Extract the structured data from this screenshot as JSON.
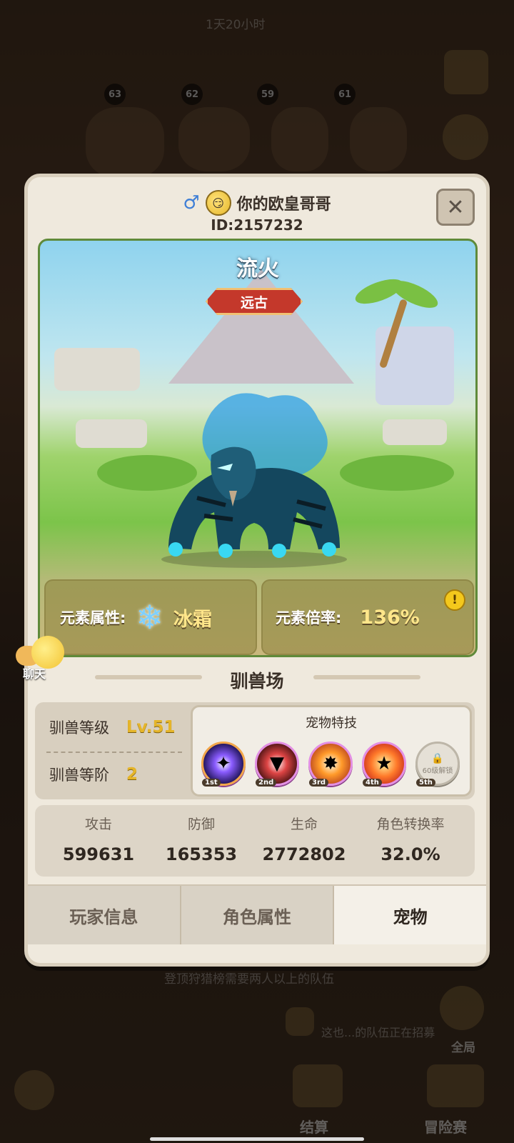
{
  "background": {
    "top_timer": "1天20小时",
    "player_levels": [
      "63",
      "62",
      "59",
      "61"
    ],
    "notice": "登顶狩猎榜需要两人以上的队伍",
    "team_notice": "这也...的队伍正在招募",
    "btn_global": "全局",
    "btn_settle": "结算",
    "btn_adventure": "冒险赛"
  },
  "header": {
    "gender_symbol": "♂",
    "player_name": "你的欧皇哥哥",
    "player_id": "ID:2157232",
    "close_symbol": "✕"
  },
  "pet": {
    "name": "流火",
    "rarity": "远古",
    "element_label": "元素属性:",
    "element_value": "冰霜",
    "multiplier_label": "元素倍率:",
    "multiplier_value": "136%",
    "info_symbol": "!"
  },
  "arena": {
    "title": "驯兽场",
    "tame_level_label": "驯兽等级",
    "tame_level_value": "Lv.51",
    "tame_rank_label": "驯兽等阶",
    "tame_rank_value": "2",
    "skills_title": "宠物特技",
    "skills": [
      {
        "order": "1st",
        "icon": "vortex-skill-icon"
      },
      {
        "order": "2nd",
        "icon": "bite-skill-icon"
      },
      {
        "order": "3rd",
        "icon": "burst-skill-icon"
      },
      {
        "order": "4th",
        "icon": "strike-skill-icon"
      },
      {
        "order": "5th",
        "locked_text": "60级解锁"
      }
    ]
  },
  "attributes": [
    {
      "label": "攻击",
      "value": "599631"
    },
    {
      "label": "防御",
      "value": "165353"
    },
    {
      "label": "生命",
      "value": "2772802"
    },
    {
      "label": "角色转换率",
      "value": "32.0%"
    }
  ],
  "tabs": [
    "玩家信息",
    "角色属性",
    "宠物"
  ],
  "chat": {
    "label": "聊天"
  },
  "colors": {
    "accent": "#e5b52a",
    "rarity": "#c4382b",
    "element": "#7fd0ff"
  }
}
